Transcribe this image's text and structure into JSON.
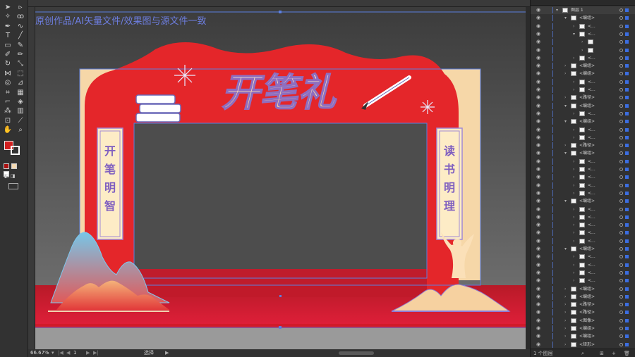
{
  "canvas": {
    "watermark": "原创作品/AI矢量文件/效果图与源文件一致",
    "arch_title": "开笔礼",
    "left_banner": [
      "开",
      "笔",
      "明",
      "智"
    ],
    "right_banner": [
      "读",
      "书",
      "明",
      "理"
    ]
  },
  "toolbar": {
    "tools": [
      "selection-icon",
      "direct-selection-icon",
      "magic-wand-icon",
      "lasso-icon",
      "pen-icon",
      "curvature-icon",
      "type-icon",
      "line-icon",
      "rectangle-icon",
      "paintbrush-icon",
      "shaper-icon",
      "pencil-icon",
      "rotate-icon",
      "scale-icon",
      "width-icon",
      "free-transform-icon",
      "shape-builder-icon",
      "perspective-icon",
      "mesh-icon",
      "gradient-icon",
      "eyedropper-icon",
      "blend-icon",
      "symbol-sprayer-icon",
      "column-graph-icon",
      "artboard-icon",
      "slice-icon",
      "hand-icon",
      "zoom-icon"
    ],
    "colors": {
      "fill": "#d22020",
      "stroke": "#ffffff"
    }
  },
  "status": {
    "zoom": "66.67%",
    "artboard": "1",
    "tool": "选择"
  },
  "layers_panel": {
    "top_layer": "图层 1",
    "rows": [
      {
        "label": "图层 1",
        "indent": 0,
        "thumb": true,
        "expanded": true
      },
      {
        "label": "<编组>",
        "indent": 1,
        "thumb": true,
        "expanded": true
      },
      {
        "label": "<...",
        "indent": 2,
        "thumb": true,
        "expanded": false
      },
      {
        "label": "<...",
        "indent": 2,
        "thumb": true,
        "expanded": true
      },
      {
        "label": "",
        "indent": 3,
        "thumb": true,
        "expanded": false
      },
      {
        "label": "",
        "indent": 3,
        "thumb": true,
        "expanded": false
      },
      {
        "label": "<...",
        "indent": 2,
        "thumb": true,
        "expanded": false
      },
      {
        "label": "<编组>",
        "indent": 1,
        "thumb": true,
        "expanded": false
      },
      {
        "label": "<编组>",
        "indent": 1,
        "thumb": true,
        "expanded": false
      },
      {
        "label": "<...",
        "indent": 2,
        "thumb": true,
        "expanded": false
      },
      {
        "label": "<...",
        "indent": 2,
        "thumb": true,
        "expanded": false
      },
      {
        "label": "<路径>",
        "indent": 1,
        "thumb": true,
        "expanded": false
      },
      {
        "label": "<编组>",
        "indent": 1,
        "thumb": true,
        "expanded": true
      },
      {
        "label": "<...",
        "indent": 2,
        "thumb": true,
        "expanded": false
      },
      {
        "label": "<编组>",
        "indent": 1,
        "thumb": true,
        "expanded": true
      },
      {
        "label": "<...",
        "indent": 2,
        "thumb": true,
        "expanded": false
      },
      {
        "label": "<...",
        "indent": 2,
        "thumb": true,
        "expanded": false
      },
      {
        "label": "<路径>",
        "indent": 1,
        "thumb": true,
        "expanded": false
      },
      {
        "label": "<编组>",
        "indent": 1,
        "thumb": true,
        "expanded": true
      },
      {
        "label": "<...",
        "indent": 2,
        "thumb": true,
        "expanded": false
      },
      {
        "label": "<...",
        "indent": 2,
        "thumb": true,
        "expanded": false
      },
      {
        "label": "<...",
        "indent": 2,
        "thumb": true,
        "expanded": false
      },
      {
        "label": "<...",
        "indent": 2,
        "thumb": true,
        "expanded": false
      },
      {
        "label": "<...",
        "indent": 2,
        "thumb": true,
        "expanded": false
      },
      {
        "label": "<编组>",
        "indent": 1,
        "thumb": true,
        "expanded": true
      },
      {
        "label": "<...",
        "indent": 2,
        "thumb": true,
        "expanded": false
      },
      {
        "label": "<...",
        "indent": 2,
        "thumb": true,
        "expanded": false
      },
      {
        "label": "<...",
        "indent": 2,
        "thumb": true,
        "expanded": false
      },
      {
        "label": "<...",
        "indent": 2,
        "thumb": true,
        "expanded": false
      },
      {
        "label": "<...",
        "indent": 2,
        "thumb": true,
        "expanded": false
      },
      {
        "label": "<编组>",
        "indent": 1,
        "thumb": true,
        "expanded": true
      },
      {
        "label": "<...",
        "indent": 2,
        "thumb": true,
        "expanded": false
      },
      {
        "label": "<...",
        "indent": 2,
        "thumb": true,
        "expanded": false
      },
      {
        "label": "<...",
        "indent": 2,
        "thumb": true,
        "expanded": false
      },
      {
        "label": "<...",
        "indent": 2,
        "thumb": true,
        "expanded": false
      },
      {
        "label": "<编组>",
        "indent": 1,
        "thumb": true,
        "expanded": false
      },
      {
        "label": "<编组>",
        "indent": 1,
        "thumb": true,
        "expanded": false
      },
      {
        "label": "<路径>",
        "indent": 1,
        "thumb": true,
        "expanded": false
      },
      {
        "label": "<路径>",
        "indent": 1,
        "thumb": true,
        "expanded": false
      },
      {
        "label": "<图像>",
        "indent": 1,
        "thumb": true,
        "expanded": false
      },
      {
        "label": "<编组>",
        "indent": 1,
        "thumb": true,
        "expanded": false
      },
      {
        "label": "<编组>",
        "indent": 1,
        "thumb": true,
        "expanded": false
      },
      {
        "label": "<矩形>",
        "indent": 1,
        "thumb": true,
        "expanded": false
      }
    ],
    "footer_count": "1 个图层"
  }
}
